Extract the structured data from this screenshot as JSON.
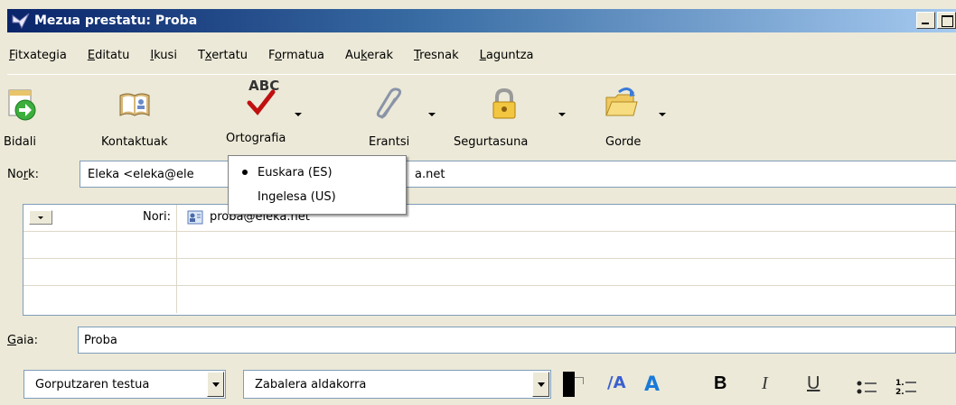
{
  "window": {
    "title": "Mezua prestatu: Proba"
  },
  "menu": [
    {
      "pre": "",
      "acc": "F",
      "post": "itxategia"
    },
    {
      "pre": "",
      "acc": "E",
      "post": "ditatu"
    },
    {
      "pre": "",
      "acc": "I",
      "post": "kusi"
    },
    {
      "pre": "T",
      "acc": "x",
      "post": "ertatu"
    },
    {
      "pre": "F",
      "acc": "o",
      "post": "rmatua"
    },
    {
      "pre": "Au",
      "acc": "k",
      "post": "erak"
    },
    {
      "pre": "",
      "acc": "T",
      "post": "resnak"
    },
    {
      "pre": "",
      "acc": "L",
      "post": "aguntza"
    }
  ],
  "toolbar": {
    "send": "Bidali",
    "contacts": "Kontaktuak",
    "spelling": "Ortografia",
    "spelling_abc": "ABC",
    "attach": "Erantsi",
    "security": "Segurtasuna",
    "save": "Gorde"
  },
  "from": {
    "label_pre": "No",
    "label_acc": "r",
    "label_post": "k:",
    "value_start": "Eleka <eleka@ele",
    "value_end": "a.net"
  },
  "recipients": [
    {
      "type": "Nori:",
      "address": "proba@eleka.net"
    }
  ],
  "subject": {
    "label_acc": "G",
    "label_post": "aia:",
    "value": "Proba"
  },
  "format": {
    "paragraph_style": "Gorputzaren testua",
    "font": "Zabalera aldakorra"
  },
  "spell_menu": {
    "items": [
      {
        "label": "Euskara (ES)",
        "selected": true
      },
      {
        "label": "Ingelesa (US)",
        "selected": false
      }
    ]
  }
}
